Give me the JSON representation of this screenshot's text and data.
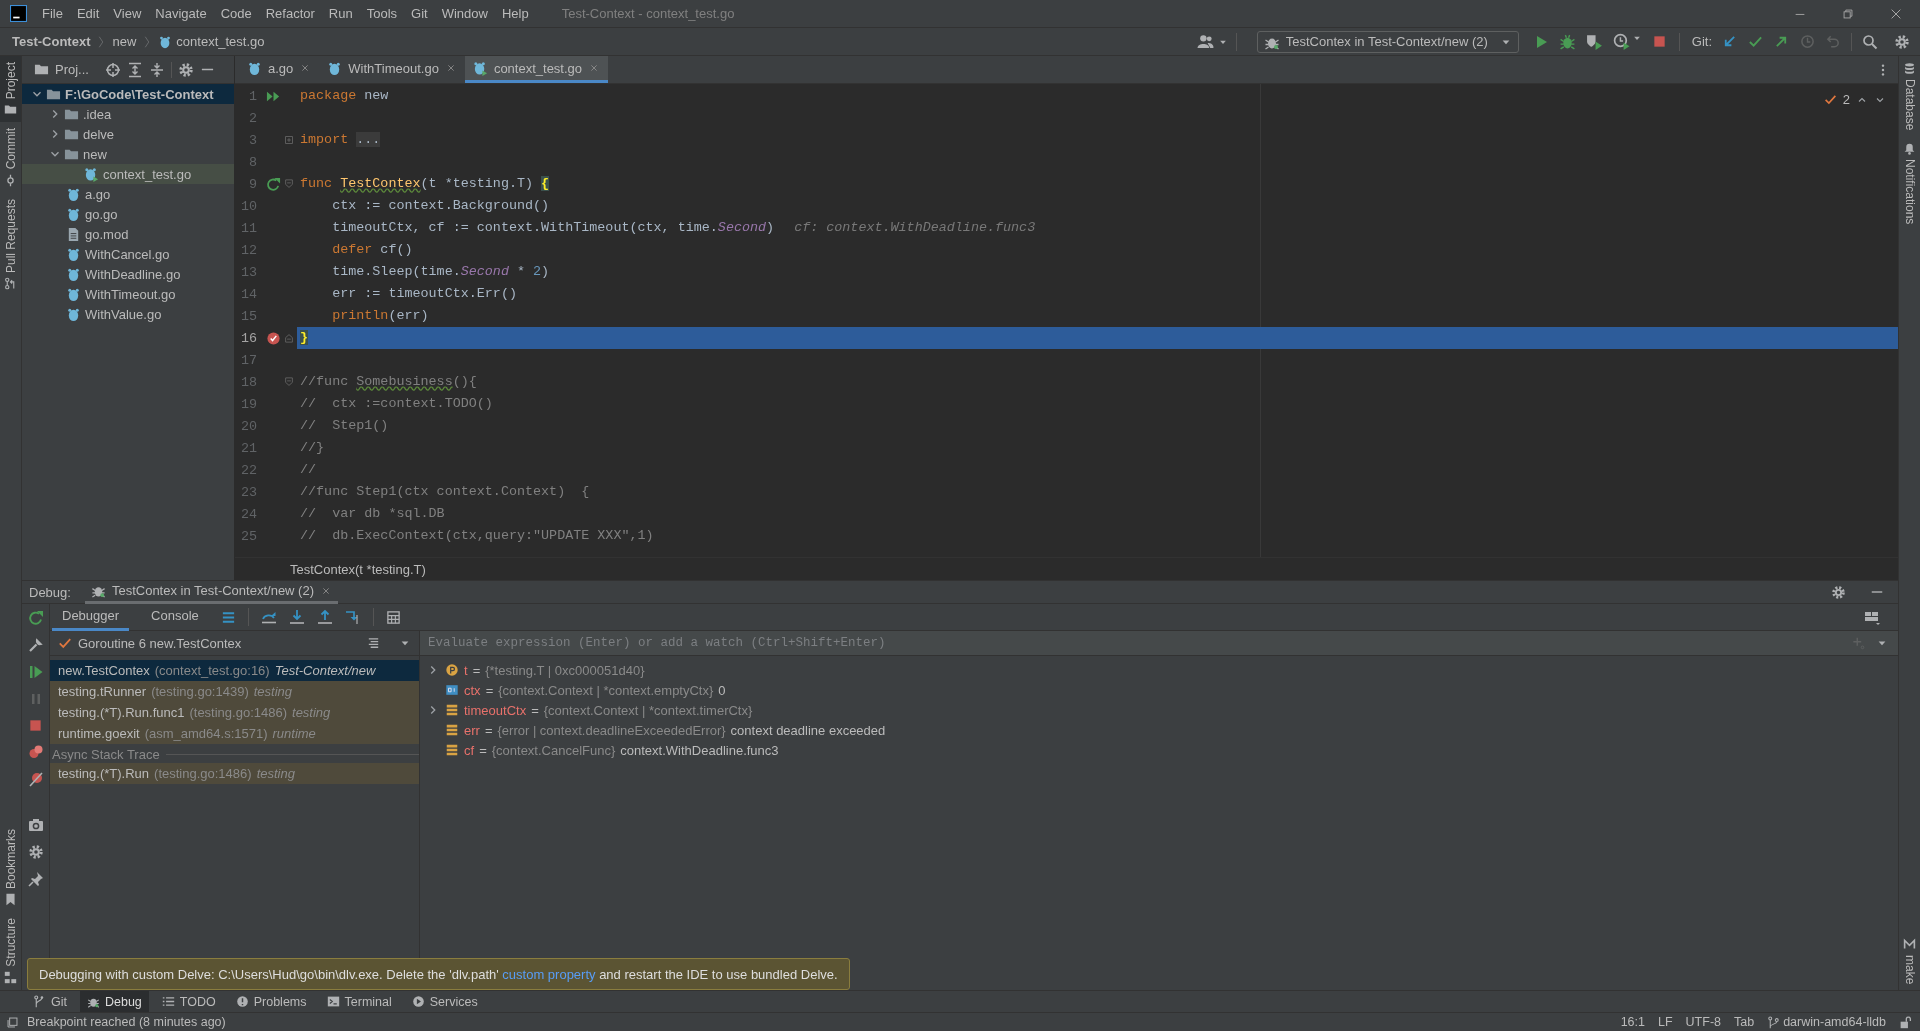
{
  "title_bar": {
    "menu": [
      "File",
      "Edit",
      "View",
      "Navigate",
      "Code",
      "Refactor",
      "Run",
      "Tools",
      "Git",
      "Window",
      "Help"
    ],
    "title": "Test-Context - context_test.go"
  },
  "nav_bar": {
    "breadcrumbs": [
      "Test-Context",
      "new",
      "context_test.go"
    ],
    "run_config": "TestContex in Test-Context/new (2)",
    "git_label": "Git:"
  },
  "left_stripe": {
    "top": [
      {
        "label": "Project",
        "selected": true
      },
      {
        "label": "Commit",
        "selected": false
      },
      {
        "label": "Pull Requests",
        "selected": false
      }
    ],
    "bottom": [
      {
        "label": "Bookmarks",
        "selected": false
      },
      {
        "label": "Structure",
        "selected": false
      }
    ]
  },
  "right_stripe": {
    "top": [
      {
        "label": "Database"
      },
      {
        "label": "Notifications"
      }
    ],
    "bottom": [
      {
        "label": "make"
      }
    ]
  },
  "project": {
    "title": "Proj...",
    "tree": [
      {
        "label": "F:\\GoCode\\Test-Context",
        "kind": "folder",
        "expanded": true,
        "selected": true,
        "open": false,
        "children": [
          {
            "label": ".idea",
            "kind": "folder",
            "expanded": false,
            "selected": false,
            "open": false
          },
          {
            "label": "delve",
            "kind": "folder",
            "expanded": false,
            "selected": false,
            "open": false
          },
          {
            "label": "new",
            "kind": "folder",
            "expanded": true,
            "selected": false,
            "open": false,
            "children": [
              {
                "label": "context_test.go",
                "kind": "test",
                "selected": false,
                "open": true
              }
            ]
          },
          {
            "label": "a.go",
            "kind": "go",
            "selected": false,
            "open": false
          },
          {
            "label": "go.go",
            "kind": "go",
            "selected": false,
            "open": false
          },
          {
            "label": "go.mod",
            "kind": "mod",
            "selected": false,
            "open": false
          },
          {
            "label": "WithCancel.go",
            "kind": "go",
            "selected": false,
            "open": false
          },
          {
            "label": "WithDeadline.go",
            "kind": "go",
            "selected": false,
            "open": false
          },
          {
            "label": "WithTimeout.go",
            "kind": "go",
            "selected": false,
            "open": false
          },
          {
            "label": "WithValue.go",
            "kind": "go",
            "selected": false,
            "open": false
          }
        ]
      }
    ]
  },
  "editor": {
    "tabs": [
      {
        "label": "a.go",
        "kind": "go",
        "selected": false
      },
      {
        "label": "WithTimeout.go",
        "kind": "go",
        "selected": false
      },
      {
        "label": "context_test.go",
        "kind": "test",
        "selected": true
      }
    ],
    "inspections": "2",
    "lines": [
      {
        "number": "1",
        "current": false,
        "gutter": {
          "kind": "run"
        },
        "tokens": [
          {
            "kind": "keyword",
            "text": "package"
          },
          {
            "kind": "plain",
            "text": " new"
          }
        ]
      },
      {
        "number": "2",
        "current": false
      },
      {
        "number": "3",
        "current": false,
        "fold": {
          "kind": "collapsed"
        },
        "tokens": [
          {
            "kind": "keyword",
            "text": "import "
          },
          {
            "kind": "folded",
            "text": "..."
          }
        ]
      },
      {
        "number": "8",
        "current": false
      },
      {
        "number": "9",
        "current": false,
        "gutter": {
          "kind": "rerun"
        },
        "fold": {
          "kind": "start"
        },
        "tokens": [
          {
            "kind": "keyword",
            "text": "func "
          },
          {
            "kind": "function_typo",
            "text": "TestContex"
          },
          {
            "kind": "plain",
            "text": "(t *testing.T) "
          },
          {
            "kind": "brace",
            "text": "{"
          }
        ]
      },
      {
        "number": "10",
        "current": false,
        "tokens": [
          {
            "kind": "plain",
            "text": "    ctx := context.Background()"
          }
        ]
      },
      {
        "number": "11",
        "current": false,
        "tokens": [
          {
            "kind": "plain",
            "text": "    timeoutCtx, cf := context.WithTimeout(ctx, time."
          },
          {
            "kind": "constant",
            "text": "Second"
          },
          {
            "kind": "plain",
            "text": ")"
          },
          {
            "kind": "hint",
            "text": "cf: context.WithDeadline.func3"
          }
        ]
      },
      {
        "number": "12",
        "current": false,
        "tokens": [
          {
            "kind": "keyword",
            "text": "    defer"
          },
          {
            "kind": "plain",
            "text": " cf()"
          }
        ]
      },
      {
        "number": "13",
        "current": false,
        "tokens": [
          {
            "kind": "plain",
            "text": "    time.Sleep(time."
          },
          {
            "kind": "constant",
            "text": "Second"
          },
          {
            "kind": "plain",
            "text": " * "
          },
          {
            "kind": "number",
            "text": "2"
          },
          {
            "kind": "plain",
            "text": ")"
          }
        ]
      },
      {
        "number": "14",
        "current": false,
        "tokens": [
          {
            "kind": "plain",
            "text": "    err := timeoutCtx.Err()"
          }
        ]
      },
      {
        "number": "15",
        "current": false,
        "tokens": [
          {
            "kind": "builtin",
            "text": "    println"
          },
          {
            "kind": "plain",
            "text": "(err)"
          }
        ]
      },
      {
        "number": "16",
        "current": true,
        "gutter": {
          "kind": "breakpoint"
        },
        "fold": {
          "kind": "end"
        },
        "tokens": [
          {
            "kind": "brace",
            "text": "}"
          }
        ]
      },
      {
        "number": "17",
        "current": false
      },
      {
        "number": "18",
        "current": false,
        "fold": {
          "kind": "start"
        },
        "tokens": [
          {
            "kind": "comment",
            "text": "//func "
          },
          {
            "kind": "comment_typo",
            "text": "Somebusiness"
          },
          {
            "kind": "comment",
            "text": "(){"
          }
        ]
      },
      {
        "number": "19",
        "current": false,
        "tokens": [
          {
            "kind": "comment",
            "text": "//  ctx :=context.TODO()"
          }
        ]
      },
      {
        "number": "20",
        "current": false,
        "tokens": [
          {
            "kind": "comment",
            "text": "//  Step1()"
          }
        ]
      },
      {
        "number": "21",
        "current": false,
        "tokens": [
          {
            "kind": "comment",
            "text": "//}"
          }
        ]
      },
      {
        "number": "22",
        "current": false,
        "tokens": [
          {
            "kind": "comment",
            "text": "//"
          }
        ]
      },
      {
        "number": "23",
        "current": false,
        "tokens": [
          {
            "kind": "comment",
            "text": "//func Step1(ctx context.Context)  {"
          }
        ]
      },
      {
        "number": "24",
        "current": false,
        "tokens": [
          {
            "kind": "comment",
            "text": "//  var db *sql.DB"
          }
        ]
      },
      {
        "number": "25",
        "current": false,
        "tokens": [
          {
            "kind": "comment",
            "text": "//  db.ExecContext(ctx,query:\"UPDATE XXX\",1)"
          }
        ]
      }
    ],
    "breadcrumb": "TestContex(t *testing.T)"
  },
  "debug": {
    "label": "Debug:",
    "session": "TestContex in Test-Context/new (2)",
    "tabs": [
      {
        "label": "Debugger",
        "selected": true
      },
      {
        "label": "Console",
        "selected": false
      }
    ],
    "goroutine": "Goroutine 6 new.TestContex",
    "frames": [
      {
        "name": "new.TestContex",
        "location": "(context_test.go:16)",
        "package": "Test-Context/new",
        "selected": true
      },
      {
        "name": "testing.tRunner",
        "location": "(testing.go:1439)",
        "package": "testing",
        "selected": false
      },
      {
        "name": "testing.(*T).Run.func1",
        "location": "(testing.go:1486)",
        "package": "testing",
        "selected": false
      },
      {
        "name": "runtime.goexit",
        "location": "(asm_amd64.s:1571)",
        "package": "runtime",
        "selected": false
      }
    ],
    "async_label": "Async Stack Trace",
    "async_frames": [
      {
        "name": "testing.(*T).Run",
        "location": "(testing.go:1486)",
        "package": "testing",
        "selected": false
      }
    ],
    "watch_placeholder": "Evaluate expression (Enter) or add a watch (Ctrl+Shift+Enter)",
    "variables": [
      {
        "kind": "param",
        "name": "t",
        "equals": "=",
        "type": "{*testing.T | 0xc000051d40}",
        "expandable": true
      },
      {
        "kind": "primitive",
        "name": "ctx",
        "equals": "=",
        "type": "{context.Context | *context.emptyCtx}",
        "value": "0",
        "expandable": false
      },
      {
        "kind": "field",
        "name": "timeoutCtx",
        "equals": "=",
        "type": "{context.Context | *context.timerCtx}",
        "expandable": true
      },
      {
        "kind": "field",
        "name": "err",
        "equals": "=",
        "type": "{error | context.deadlineExceededError}",
        "value": "context deadline exceeded",
        "expandable": false
      },
      {
        "kind": "field",
        "name": "cf",
        "equals": "=",
        "type": "{context.CancelFunc}",
        "value": "context.WithDeadline.func3",
        "expandable": false
      }
    ]
  },
  "notification": {
    "text_before": "Debugging with custom Delve: C:\\Users\\Hud\\go\\bin\\dlv.exe. Delete the 'dlv.path'",
    "link": "custom property",
    "text_after": "and restart the IDE to use bundled Delve."
  },
  "tool_tabs": [
    {
      "label": "Git",
      "selected": false
    },
    {
      "label": "Debug",
      "selected": true
    },
    {
      "label": "TODO",
      "selected": false
    },
    {
      "label": "Problems",
      "selected": false
    },
    {
      "label": "Terminal",
      "selected": false
    },
    {
      "label": "Services",
      "selected": false
    }
  ],
  "status_bar": {
    "message": "Breakpoint reached (8 minutes ago)",
    "position": "16:1",
    "line_ending": "LF",
    "encoding": "UTF-8",
    "indent": "Tab",
    "branch": "darwin-amd64-lldb"
  }
}
